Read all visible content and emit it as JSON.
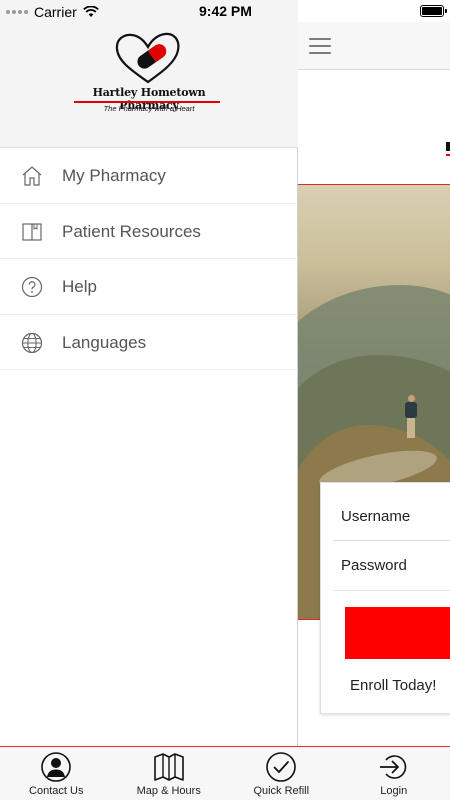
{
  "status_bar": {
    "carrier": "Carrier",
    "time": "9:42 PM"
  },
  "drawer": {
    "logo": {
      "name": "Hartley Hometown Pharmacy",
      "tagline": "The Pharmacy with a Heart",
      "colors": {
        "accent": "#e30000",
        "ink": "#111111"
      }
    },
    "items": [
      {
        "label": "My Pharmacy",
        "icon": "home-icon"
      },
      {
        "label": "Patient Resources",
        "icon": "book-icon"
      },
      {
        "label": "Help",
        "icon": "question-icon"
      },
      {
        "label": "Languages",
        "icon": "globe-icon"
      }
    ]
  },
  "main": {
    "login": {
      "username_label": "Username",
      "password_label": "Password",
      "enroll_label": "Enroll Today!",
      "button_color": "#fe0000"
    }
  },
  "tabbar": {
    "tabs": [
      {
        "label": "Contact Us",
        "icon": "person-icon"
      },
      {
        "label": "Map & Hours",
        "icon": "map-icon"
      },
      {
        "label": "Quick Refill",
        "icon": "check-circle-icon"
      },
      {
        "label": "Login",
        "icon": "login-icon"
      }
    ]
  }
}
